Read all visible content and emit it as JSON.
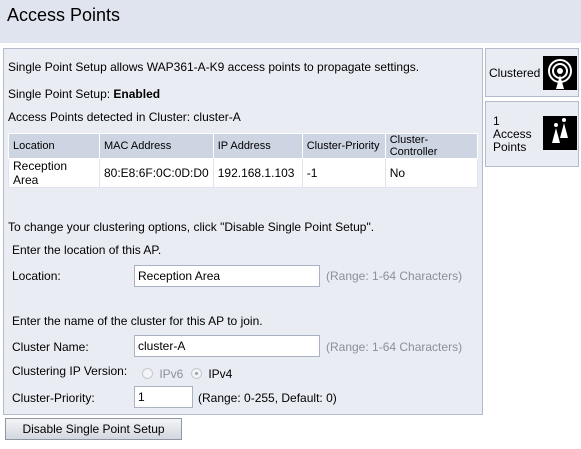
{
  "page": {
    "title": "Access Points"
  },
  "intro": {
    "description": "Single Point Setup allows WAP361-A-K9 access points to propagate settings.",
    "status_label": "Single Point Setup:",
    "status_value": "Enabled",
    "detected": "Access Points detected in Cluster: cluster-A"
  },
  "table": {
    "headers": [
      "Location",
      "MAC Address",
      "IP Address",
      "Cluster-Priority",
      "Cluster-Controller"
    ],
    "rows": [
      [
        "Reception Area",
        "80:E8:6F:0C:0D:D0",
        "192.168.1.103",
        "-1",
        "No"
      ]
    ]
  },
  "form": {
    "change_note": "To change your clustering options, click \"Disable Single Point Setup\".",
    "location_prompt": "Enter the location of this AP.",
    "location_label": "Location:",
    "location_value": "Reception Area",
    "location_hint": "(Range: 1-64 Characters)",
    "cluster_prompt": "Enter the name of the cluster for this AP to join.",
    "cluster_label": "Cluster Name:",
    "cluster_value": "cluster-A",
    "cluster_hint": "(Range: 1-64 Characters)",
    "ip_version_label": "Clustering IP Version:",
    "ip_options": [
      "IPv6",
      "IPv4"
    ],
    "ip_selected": "IPv4",
    "priority_label": "Cluster-Priority:",
    "priority_value": "1",
    "priority_hint": "(Range: 0-255, Default: 0)"
  },
  "actions": {
    "disable_button": "Disable Single Point Setup"
  },
  "sidebar": {
    "clustered_label": "Clustered",
    "clustered_icon": "wireless-broadcast-icon",
    "ap_count": "1",
    "ap_label_line1": "Access",
    "ap_label_line2": "Points",
    "ap_icon": "access-points-icon"
  },
  "colors": {
    "title_bar": "#dfe4ee",
    "panel": "#e9ecf3",
    "table_header": "#cdd5e3",
    "hint_text": "#8a8f99"
  }
}
